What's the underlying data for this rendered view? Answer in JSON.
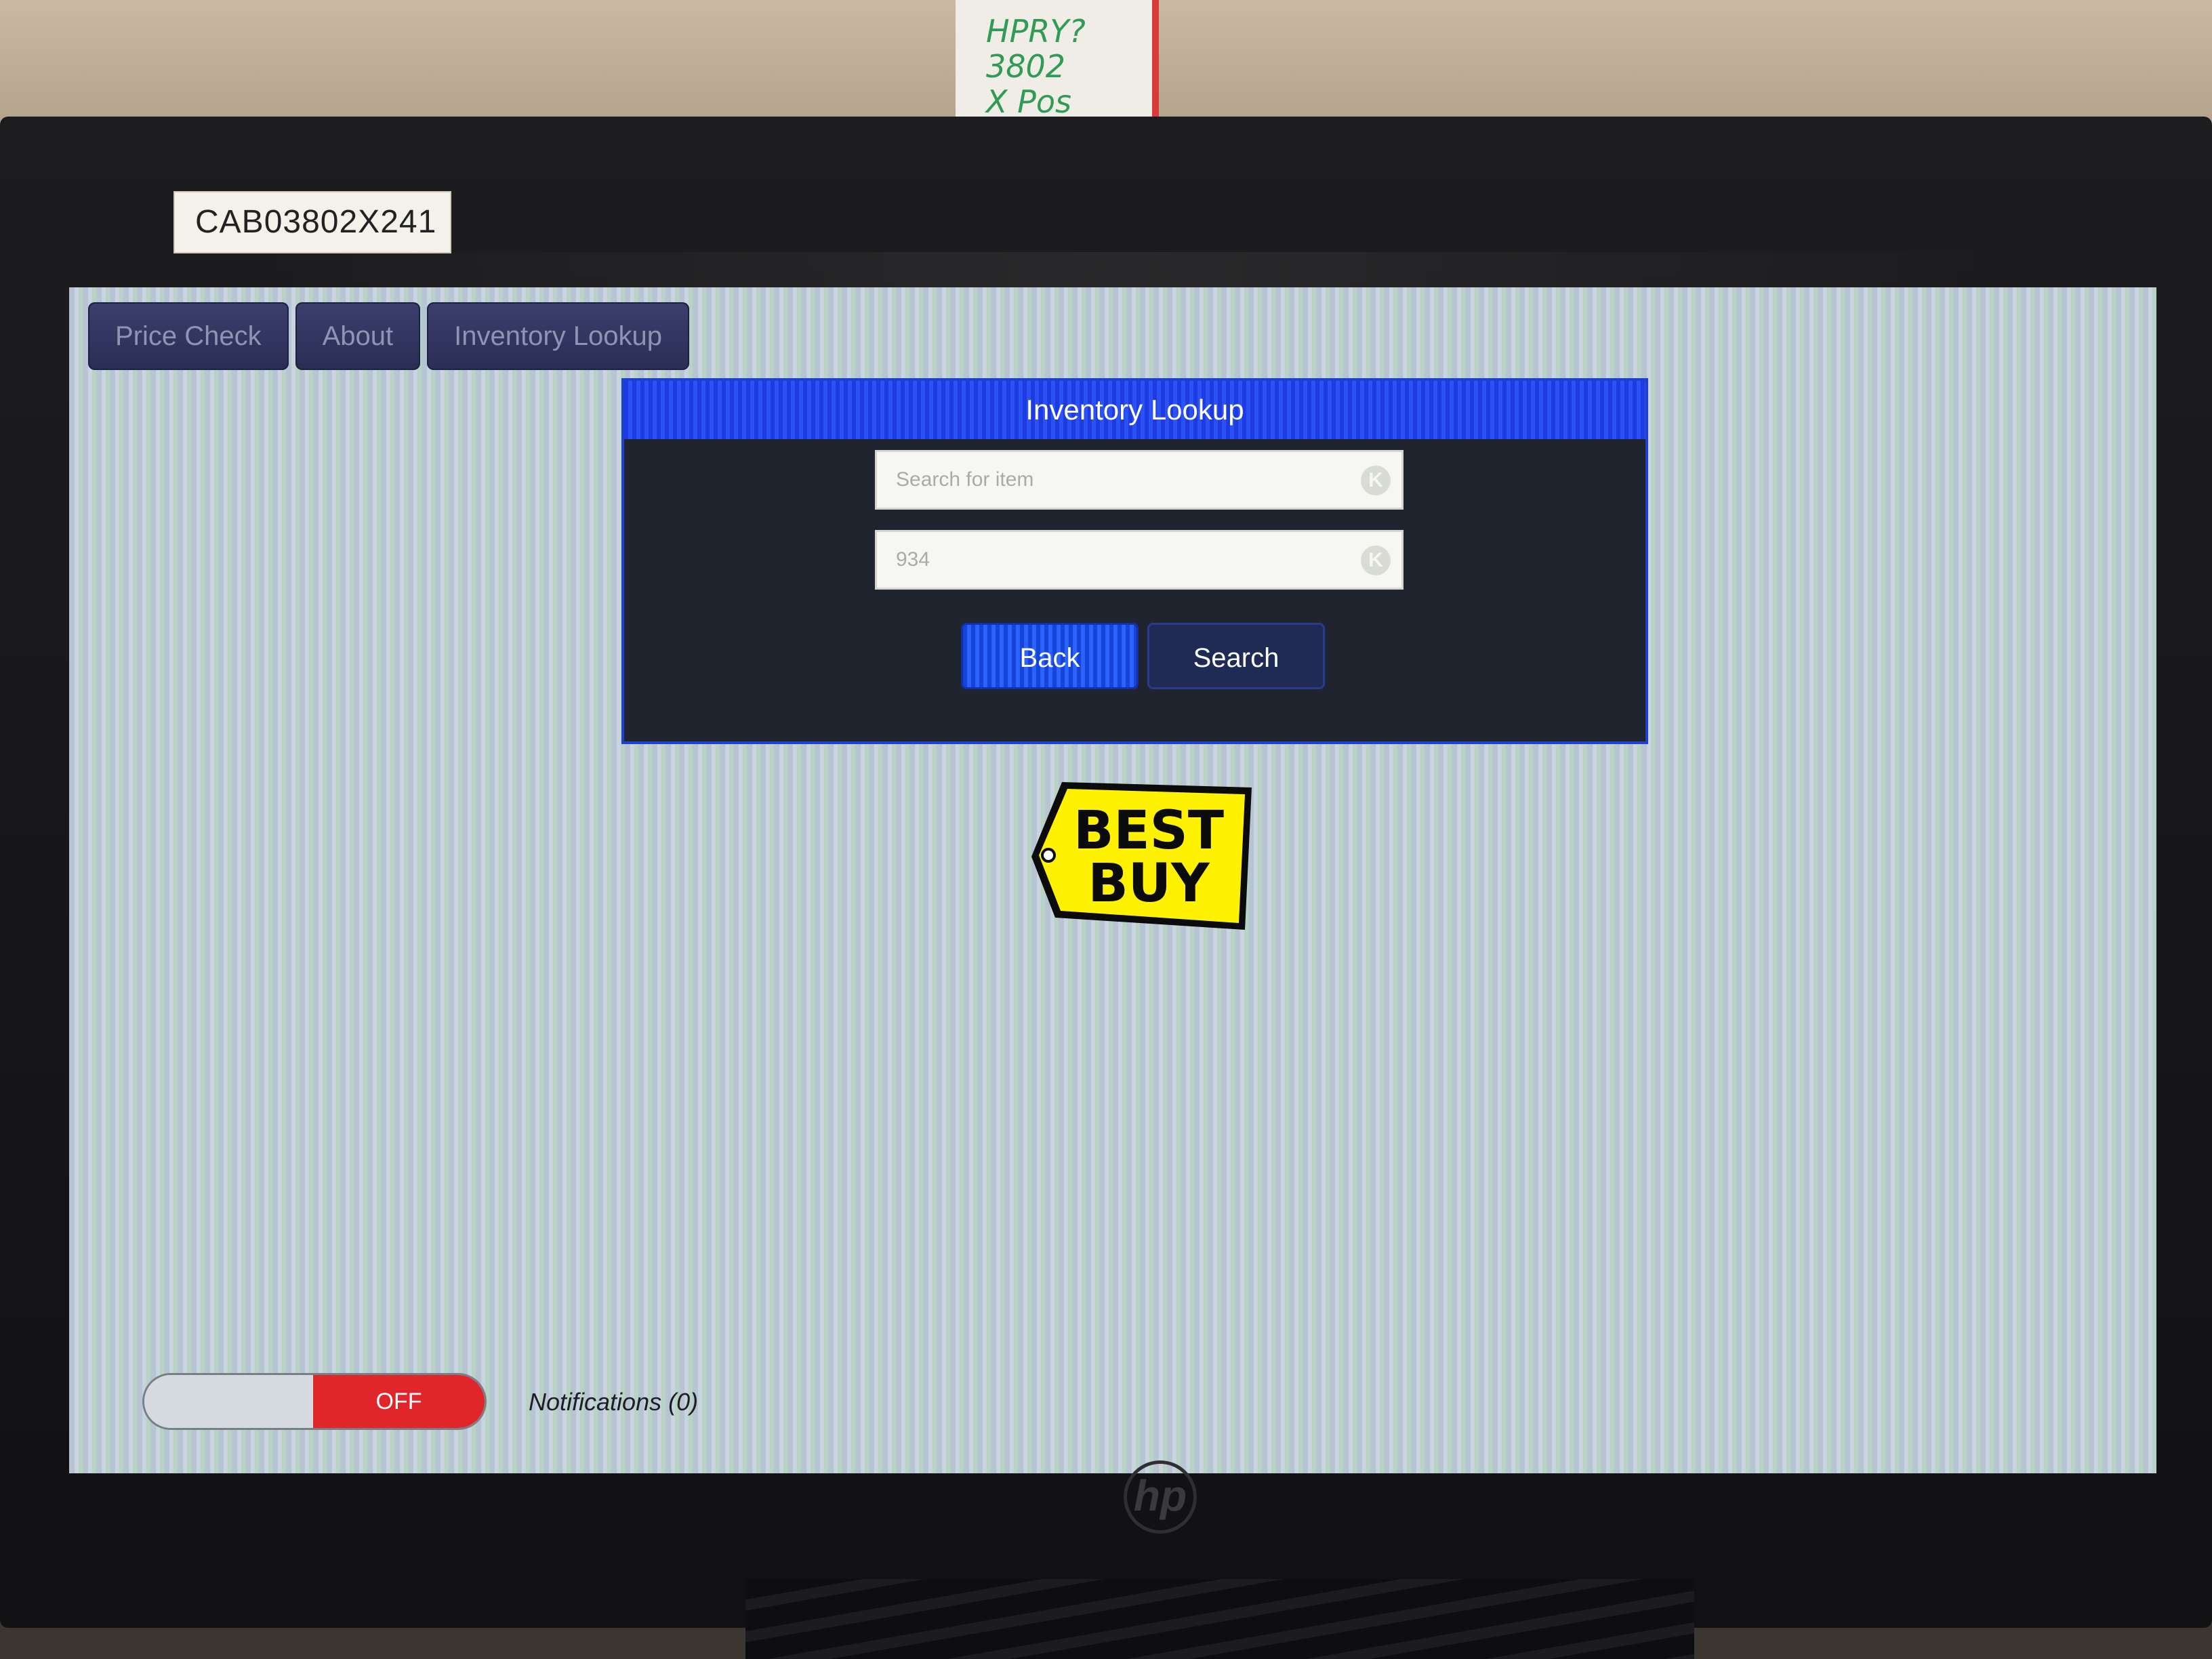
{
  "asset_tag": "CAB03802X241",
  "sticky_note": {
    "line1": "HPRY?",
    "line2": "3802",
    "line3": "X Pos"
  },
  "tabs": [
    {
      "label": "Price Check"
    },
    {
      "label": "About"
    },
    {
      "label": "Inventory Lookup"
    }
  ],
  "dialog": {
    "title": "Inventory Lookup",
    "search_field": {
      "placeholder": "Search for item",
      "value": ""
    },
    "quantity_field": {
      "placeholder": "934",
      "value": ""
    },
    "back_label": "Back",
    "search_label": "Search"
  },
  "logo": {
    "line1": "BEST",
    "line2": "BUY",
    "color": "#fff200"
  },
  "notifications": {
    "toggle_label": "OFF",
    "label": "Notifications (0)"
  },
  "monitor_brand": "hp",
  "colors": {
    "accent_blue": "#2a63ff",
    "toggle_off_red": "#e0262b"
  }
}
